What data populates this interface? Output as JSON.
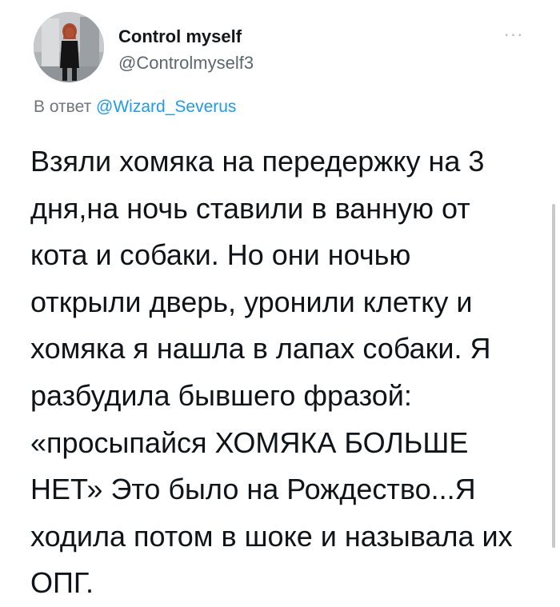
{
  "author": {
    "display_name": "Control myself",
    "handle": "@Controlmyself3",
    "avatar_icon": "user-photo-avatar"
  },
  "menu": {
    "more_icon": "more-horizontal-icon",
    "more_glyph": "···"
  },
  "reply": {
    "prefix": "В ответ",
    "mention": "@Wizard_Severus"
  },
  "tweet": {
    "lines": [
      "Взяли хомяка на передержку на 3",
      "дня,на ночь ставили в ванную от",
      "кота и собаки. Но они ночью",
      "открыли дверь, уронили клетку и",
      "хомяка я нашла в лапах собаки. Я",
      "разбудила бывшего фразой:",
      "«просыпайся ХОМЯКА БОЛЬШЕ",
      "НЕТ» Это было на Рождество...Я",
      "ходила потом в шоке и называла их",
      "ОПГ."
    ]
  },
  "colors": {
    "text": "#0f1419",
    "secondary": "#5b6770",
    "link": "#1d9bf0",
    "background": "#ffffff"
  }
}
